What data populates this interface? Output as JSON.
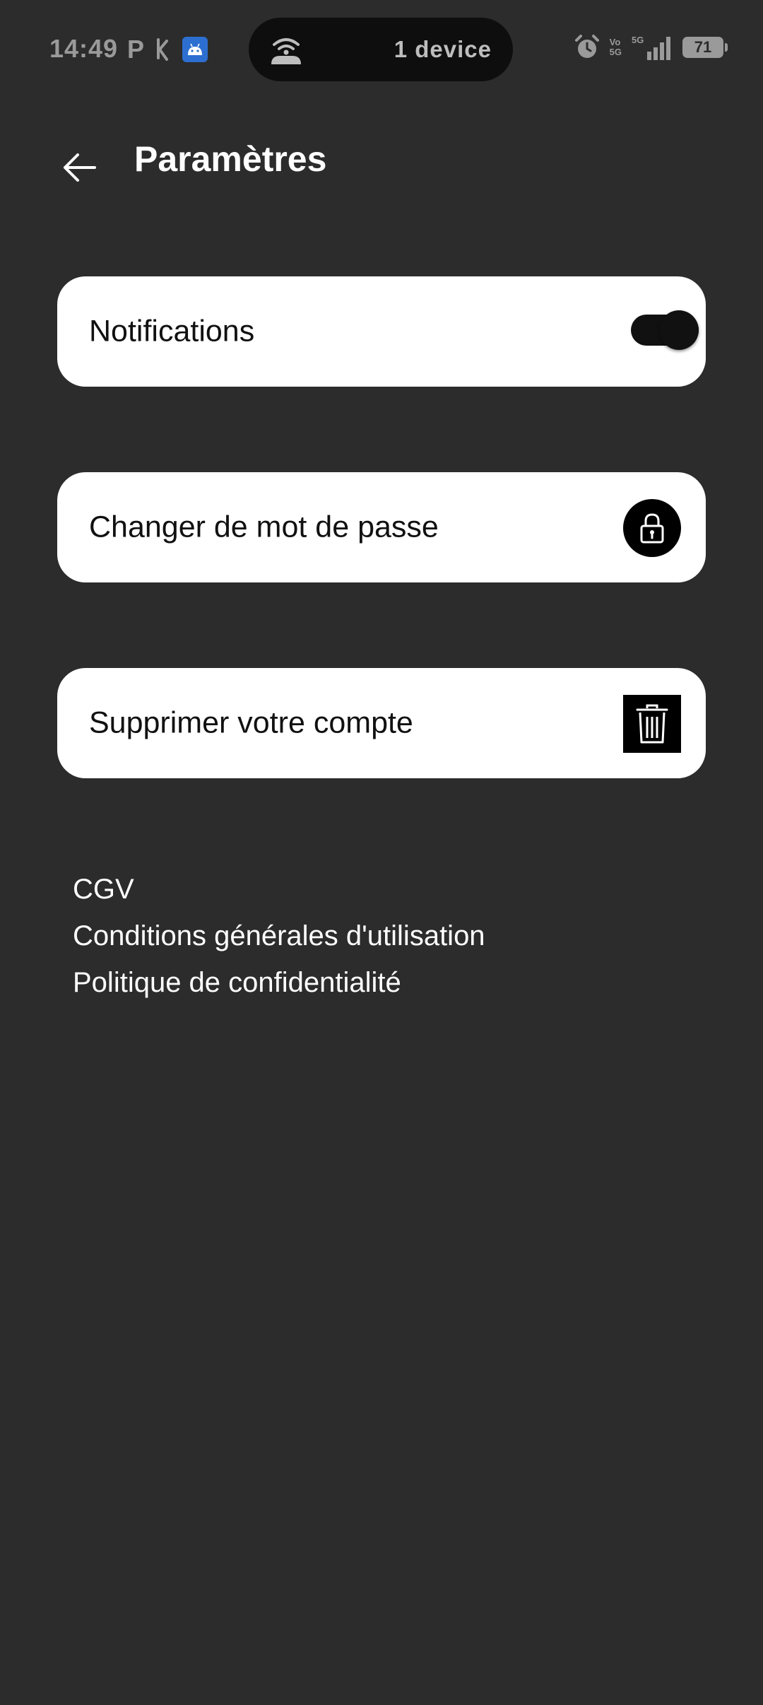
{
  "status_bar": {
    "time": "14:49",
    "left_icons": [
      "p-icon",
      "k-icon",
      "android-icon"
    ],
    "pill_text": "1 device",
    "volte_top": "Vo",
    "volte_bottom": "5G",
    "network": "5G",
    "battery": "71"
  },
  "header": {
    "title": "Paramètres"
  },
  "settings": {
    "notifications_label": "Notifications",
    "notifications_enabled": true,
    "password_label": "Changer de mot de passe",
    "delete_label": "Supprimer votre compte"
  },
  "links": {
    "cgv": "CGV",
    "cgu": "Conditions générales d'utilisation",
    "privacy": "Politique de confidentialité"
  },
  "colors": {
    "background": "#2c2c2c",
    "card": "#ffffff",
    "text_dark": "#111111",
    "text_light": "#ffffff"
  }
}
